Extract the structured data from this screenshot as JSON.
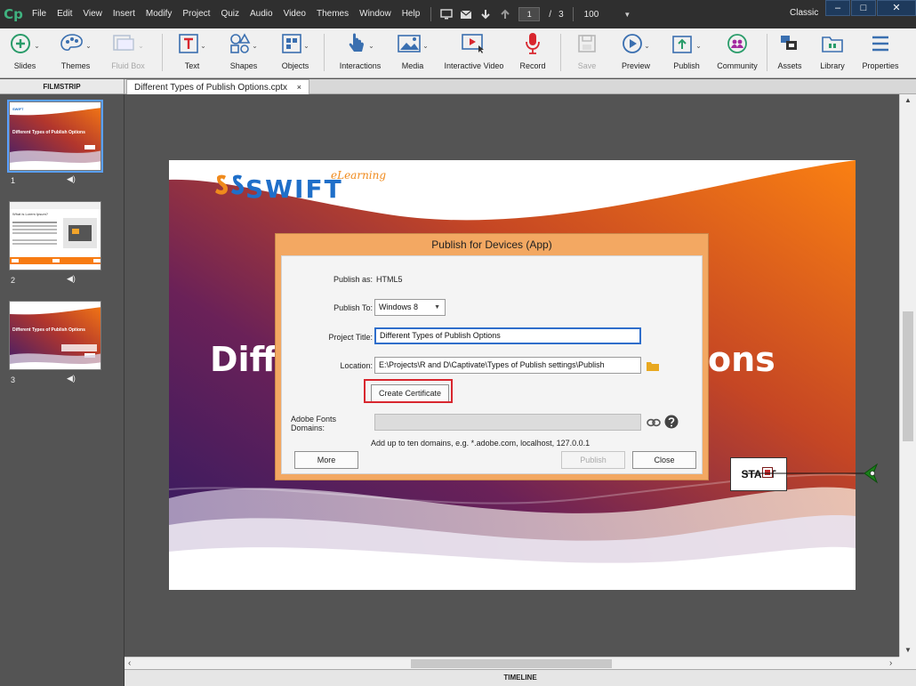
{
  "app": {
    "logo": "Cp",
    "menu": [
      "File",
      "Edit",
      "View",
      "Insert",
      "Modify",
      "Project",
      "Quiz",
      "Audio",
      "Video",
      "Themes",
      "Window",
      "Help"
    ],
    "slide_current": "1",
    "slide_separator": "/",
    "slide_total": "3",
    "zoom": "100",
    "workspace": "Classic",
    "window_controls": [
      "–",
      "□",
      "✕"
    ]
  },
  "toolbar": {
    "slides": "Slides",
    "themes": "Themes",
    "fluid_box": "Fluid Box",
    "text": "Text",
    "shapes": "Shapes",
    "objects": "Objects",
    "interactions": "Interactions",
    "media": "Media",
    "interactive_video": "Interactive Video",
    "record": "Record",
    "save": "Save",
    "preview": "Preview",
    "publish": "Publish",
    "community": "Community",
    "assets": "Assets",
    "library": "Library",
    "properties": "Properties"
  },
  "filmstrip": {
    "header": "FILMSTRIP",
    "slides": [
      {
        "number": "1",
        "caption": "Different Types of Publish Options"
      },
      {
        "number": "2",
        "caption": "What is Lorem Ipsum?"
      },
      {
        "number": "3",
        "caption": "Different Types of Publish Options"
      }
    ]
  },
  "document": {
    "tab_title": "Different Types of Publish Options.cptx",
    "tab_close": "×"
  },
  "slide": {
    "logo_text": "SWIFT",
    "logo_tagline": "eLearning",
    "title_left": "Diffe",
    "title_right": "ons",
    "start_label": "START"
  },
  "dialog": {
    "title": "Publish for Devices (App)",
    "publish_as_label": "Publish as:",
    "publish_as_value": "HTML5",
    "publish_to_label": "Publish To:",
    "publish_to_value": "Windows 8",
    "project_title_label": "Project Title:",
    "project_title_value": "Different Types of Publish Options",
    "location_label": "Location:",
    "location_value": "E:\\Projects\\R and D\\Captivate\\Types of Publish settings\\Publish",
    "create_certificate": "Create Certificate",
    "fonts_domains_label": "Adobe Fonts Domains:",
    "fonts_domains_value": "",
    "fonts_hint": "Add up to ten domains, e.g. *.adobe.com, localhost, 127.0.0.1",
    "more_button": "More",
    "publish_button": "Publish",
    "close_button": "Close"
  },
  "timeline": {
    "label": "TIMELINE"
  },
  "colors": {
    "accent": "#3fb27f",
    "dialog_header": "#f3a862",
    "highlight": "#d8262e",
    "focus": "#2f6ecb"
  }
}
